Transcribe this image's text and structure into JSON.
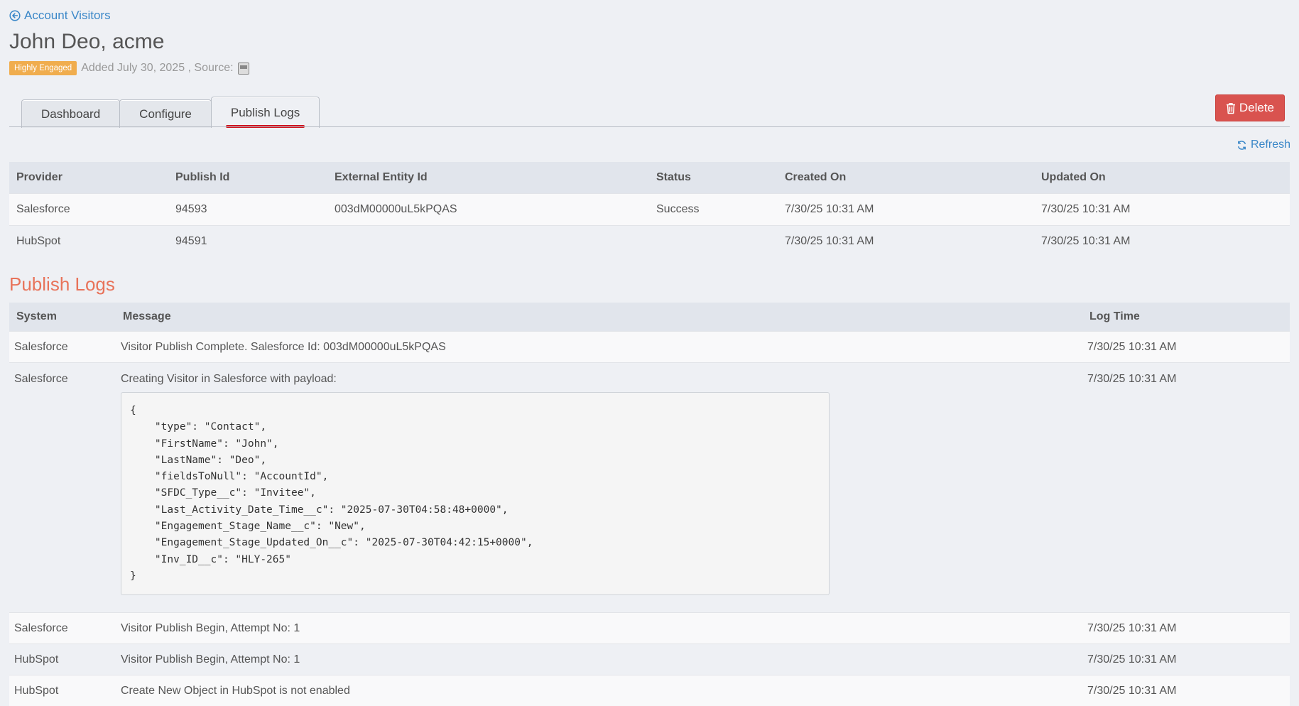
{
  "nav": {
    "back_label": "Account Visitors"
  },
  "header": {
    "title": "John Deo, acme",
    "badge": "Highly Engaged",
    "added_text": "Added July 30, 2025 , Source:"
  },
  "tabs": [
    {
      "label": "Dashboard"
    },
    {
      "label": "Configure"
    },
    {
      "label": "Publish Logs",
      "active": true
    }
  ],
  "actions": {
    "delete_label": "Delete",
    "refresh_label": "Refresh"
  },
  "publish_table": {
    "columns": [
      "Provider",
      "Publish Id",
      "External Entity Id",
      "Status",
      "Created On",
      "Updated On"
    ],
    "rows": [
      [
        "Salesforce",
        "94593",
        "003dM00000uL5kPQAS",
        "Success",
        "7/30/25 10:31 AM",
        "7/30/25 10:31 AM"
      ],
      [
        "HubSpot",
        "94591",
        "",
        "",
        "7/30/25 10:31 AM",
        "7/30/25 10:31 AM"
      ]
    ]
  },
  "logs": {
    "title": "Publish Logs",
    "columns": [
      "System",
      "Message",
      "Log Time"
    ],
    "rows": [
      {
        "system": "Salesforce",
        "message": "Visitor Publish Complete. Salesforce Id: 003dM00000uL5kPQAS",
        "time": "7/30/25 10:31 AM"
      },
      {
        "system": "Salesforce",
        "message": "Creating Visitor in Salesforce with payload:",
        "time": "7/30/25 10:31 AM",
        "payload": "{\n    \"type\": \"Contact\",\n    \"FirstName\": \"John\",\n    \"LastName\": \"Deo\",\n    \"fieldsToNull\": \"AccountId\",\n    \"SFDC_Type__c\": \"Invitee\",\n    \"Last_Activity_Date_Time__c\": \"2025-07-30T04:58:48+0000\",\n    \"Engagement_Stage_Name__c\": \"New\",\n    \"Engagement_Stage_Updated_On__c\": \"2025-07-30T04:42:15+0000\",\n    \"Inv_ID__c\": \"HLY-265\"\n}"
      },
      {
        "system": "Salesforce",
        "message": "Visitor Publish Begin, Attempt No: 1",
        "time": "7/30/25 10:31 AM"
      },
      {
        "system": "HubSpot",
        "message": "Visitor Publish Begin, Attempt No: 1",
        "time": "7/30/25 10:31 AM"
      },
      {
        "system": "HubSpot",
        "message": "Create New Object in HubSpot is not enabled",
        "time": "7/30/25 10:31 AM"
      }
    ]
  },
  "colors": {
    "link": "#3a87c8",
    "badge": "#f0ad4e",
    "danger": "#d9534f",
    "section_title": "#e8735a",
    "tab_underline": "#d0131f"
  },
  "icons": {
    "back": "arrow-circle-left-icon",
    "source": "source-icon",
    "delete": "trash-icon",
    "refresh": "refresh-icon"
  }
}
